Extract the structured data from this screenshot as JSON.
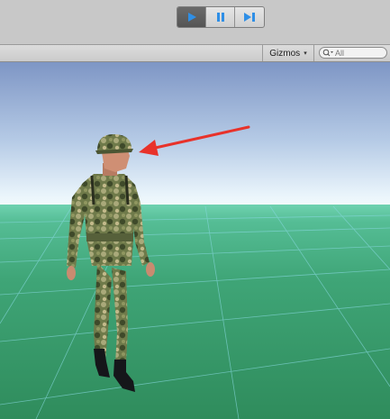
{
  "toolbar": {
    "play_icon": "play-icon",
    "pause_icon": "pause-icon",
    "step_icon": "step-icon",
    "play_active": true,
    "accent_color": "#2f8fe6"
  },
  "scene_header": {
    "gizmos_label": "Gizmos",
    "gizmos_caret": "▾",
    "search_placeholder": "All",
    "search_icon": "search-icon"
  },
  "viewport": {
    "sky_color_top": "#7d98c7",
    "sky_color_horizon": "#e8f3fb",
    "ground_color": "#3a9a6e",
    "annotation_color": "#e8322a"
  }
}
